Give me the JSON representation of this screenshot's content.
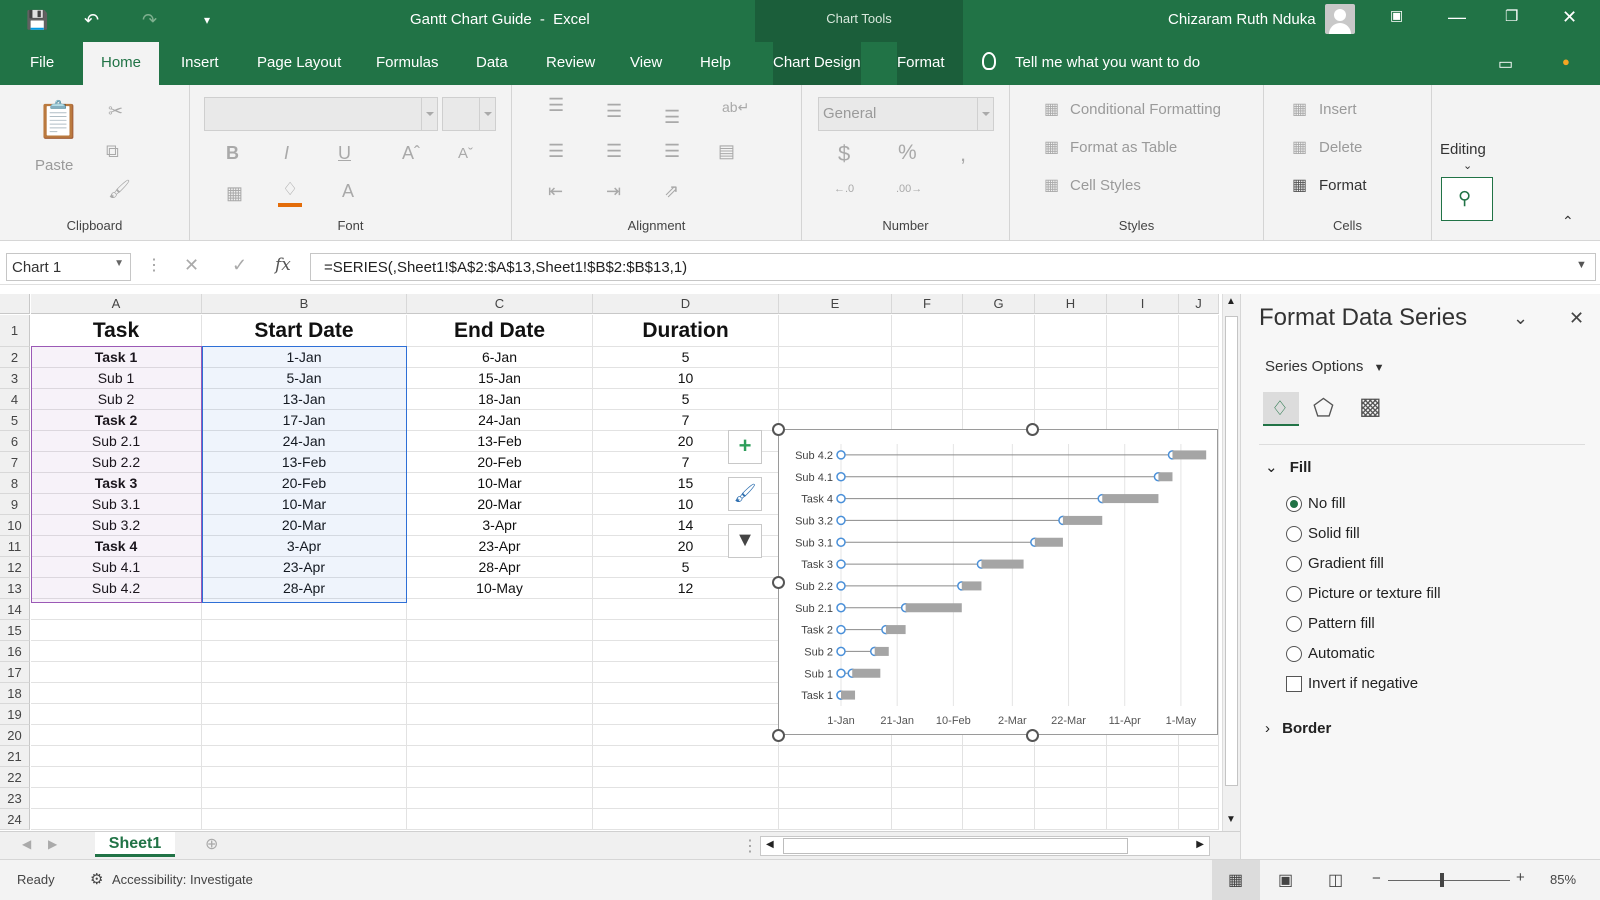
{
  "window": {
    "title": "Gantt Chart Guide",
    "app": "Excel",
    "separator": "-",
    "chart_tools": "Chart Tools",
    "user": "Chizaram Ruth Nduka"
  },
  "tabs": [
    "File",
    "Home",
    "Insert",
    "Page Layout",
    "Formulas",
    "Data",
    "Review",
    "View",
    "Help",
    "Chart Design",
    "Format"
  ],
  "active_tab": "Home",
  "tell_me": "Tell me what you want to do",
  "ribbon": {
    "clipboard": {
      "label": "Clipboard",
      "paste": "Paste"
    },
    "font": {
      "label": "Font"
    },
    "alignment": {
      "label": "Alignment"
    },
    "number": {
      "label": "Number",
      "format": "General"
    },
    "styles": {
      "label": "Styles",
      "conditional": "Conditional Formatting",
      "table": "Format as Table",
      "cell_styles": "Cell Styles"
    },
    "cells": {
      "label": "Cells",
      "insert": "Insert",
      "delete": "Delete",
      "format": "Format"
    },
    "editing": {
      "label": "Editing"
    }
  },
  "formula_bar": {
    "name_box": "Chart 1",
    "formula": "=SERIES(,Sheet1!$A$2:$A$13,Sheet1!$B$2:$B$13,1)"
  },
  "sheet": {
    "columns": [
      "A",
      "B",
      "C",
      "D",
      "E",
      "F",
      "G",
      "H",
      "I",
      "J"
    ],
    "rows": [
      "1",
      "2",
      "3",
      "4",
      "5",
      "6",
      "7",
      "8",
      "9",
      "10",
      "11",
      "12",
      "13",
      "14",
      "15",
      "16",
      "17",
      "18",
      "19",
      "20",
      "21",
      "22",
      "23",
      "24"
    ],
    "headers": [
      "Task",
      "Start Date",
      "End Date",
      "Duration"
    ],
    "data": [
      {
        "task": "Task 1",
        "start": "1-Jan",
        "end": "6-Jan",
        "duration": "5",
        "bold": true
      },
      {
        "task": "Sub 1",
        "start": "5-Jan",
        "end": "15-Jan",
        "duration": "10",
        "bold": false
      },
      {
        "task": "Sub 2",
        "start": "13-Jan",
        "end": "18-Jan",
        "duration": "5",
        "bold": false
      },
      {
        "task": "Task 2",
        "start": "17-Jan",
        "end": "24-Jan",
        "duration": "7",
        "bold": true
      },
      {
        "task": "Sub 2.1",
        "start": "24-Jan",
        "end": "13-Feb",
        "duration": "20",
        "bold": false
      },
      {
        "task": "Sub 2.2",
        "start": "13-Feb",
        "end": "20-Feb",
        "duration": "7",
        "bold": false
      },
      {
        "task": "Task 3",
        "start": "20-Feb",
        "end": "10-Mar",
        "duration": "15",
        "bold": true
      },
      {
        "task": "Sub 3.1",
        "start": "10-Mar",
        "end": "20-Mar",
        "duration": "10",
        "bold": false
      },
      {
        "task": "Sub 3.2",
        "start": "20-Mar",
        "end": "3-Apr",
        "duration": "14",
        "bold": false
      },
      {
        "task": "Task 4",
        "start": "3-Apr",
        "end": "23-Apr",
        "duration": "20",
        "bold": true
      },
      {
        "task": "Sub 4.1",
        "start": "23-Apr",
        "end": "28-Apr",
        "duration": "5",
        "bold": false
      },
      {
        "task": "Sub 4.2",
        "start": "28-Apr",
        "end": "10-May",
        "duration": "12",
        "bold": false
      }
    ],
    "tab_name": "Sheet1"
  },
  "chart_data": {
    "type": "bar",
    "orientation": "horizontal",
    "stacked": true,
    "categories": [
      "Task 1",
      "Sub 1",
      "Sub 2",
      "Task 2",
      "Sub 2.1",
      "Sub 2.2",
      "Task 3",
      "Sub 3.1",
      "Sub 3.2",
      "Task 4",
      "Sub 4.1",
      "Sub 4.2"
    ],
    "series": [
      {
        "start_dates": [
          "2024-01-01",
          "2024-01-05",
          "2024-01-13",
          "2024-01-17",
          "2024-01-24",
          "2024-02-13",
          "2024-02-20",
          "2024-03-10",
          "2024-03-20",
          "2024-04-03",
          "2024-04-23",
          "2024-04-28"
        ],
        "fill": "none",
        "selected": true
      },
      {
        "values": [
          5,
          10,
          5,
          7,
          20,
          7,
          15,
          10,
          14,
          20,
          5,
          12
        ],
        "color": "#a5a5a5"
      }
    ],
    "x_ticks": [
      "1-Jan",
      "21-Jan",
      "10-Feb",
      "2-Mar",
      "22-Mar",
      "11-Apr",
      "1-May"
    ],
    "xlim": [
      "2024-01-01",
      "2024-05-11"
    ],
    "grid": "vertical"
  },
  "pane": {
    "title": "Format Data Series",
    "series_options": "Series Options",
    "fill_label": "Fill",
    "fill_options": [
      "No fill",
      "Solid fill",
      "Gradient fill",
      "Picture or texture fill",
      "Pattern fill",
      "Automatic"
    ],
    "selected_fill": "No fill",
    "invert": "Invert if negative",
    "border_label": "Border"
  },
  "status": {
    "ready": "Ready",
    "accessibility": "Accessibility: Investigate",
    "zoom": "85%"
  }
}
